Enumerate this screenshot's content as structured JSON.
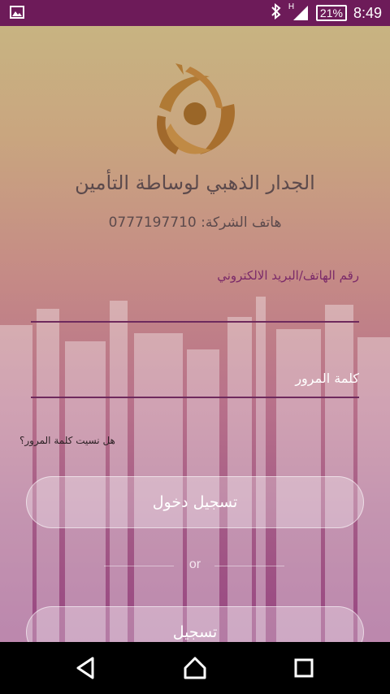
{
  "status_bar": {
    "network_type": "H",
    "battery": "21%",
    "time": "8:49",
    "icons": [
      "image-notification-icon",
      "bluetooth-icon",
      "signal-icon",
      "battery-icon"
    ]
  },
  "company": {
    "name": "الجدار الذهبي لوساطة التأمين",
    "phone_line": "هاتف الشركة: 0777197710"
  },
  "form": {
    "phone_email_label": "رقم الهاتف/البريد الالكتروني",
    "password_placeholder": "كلمة المرور",
    "forgot_password": "هل نسيت كلمة المرور؟",
    "login_button": "تسجيل دخول",
    "or_text": "or",
    "register_button": "تسجيل"
  },
  "colors": {
    "status_bar": "#6d1b59",
    "gold": "#b07a35",
    "text_dark": "#5c4a4c",
    "accent": "#7b2a69"
  },
  "navigation": [
    "back-icon",
    "home-icon",
    "recents-icon"
  ]
}
